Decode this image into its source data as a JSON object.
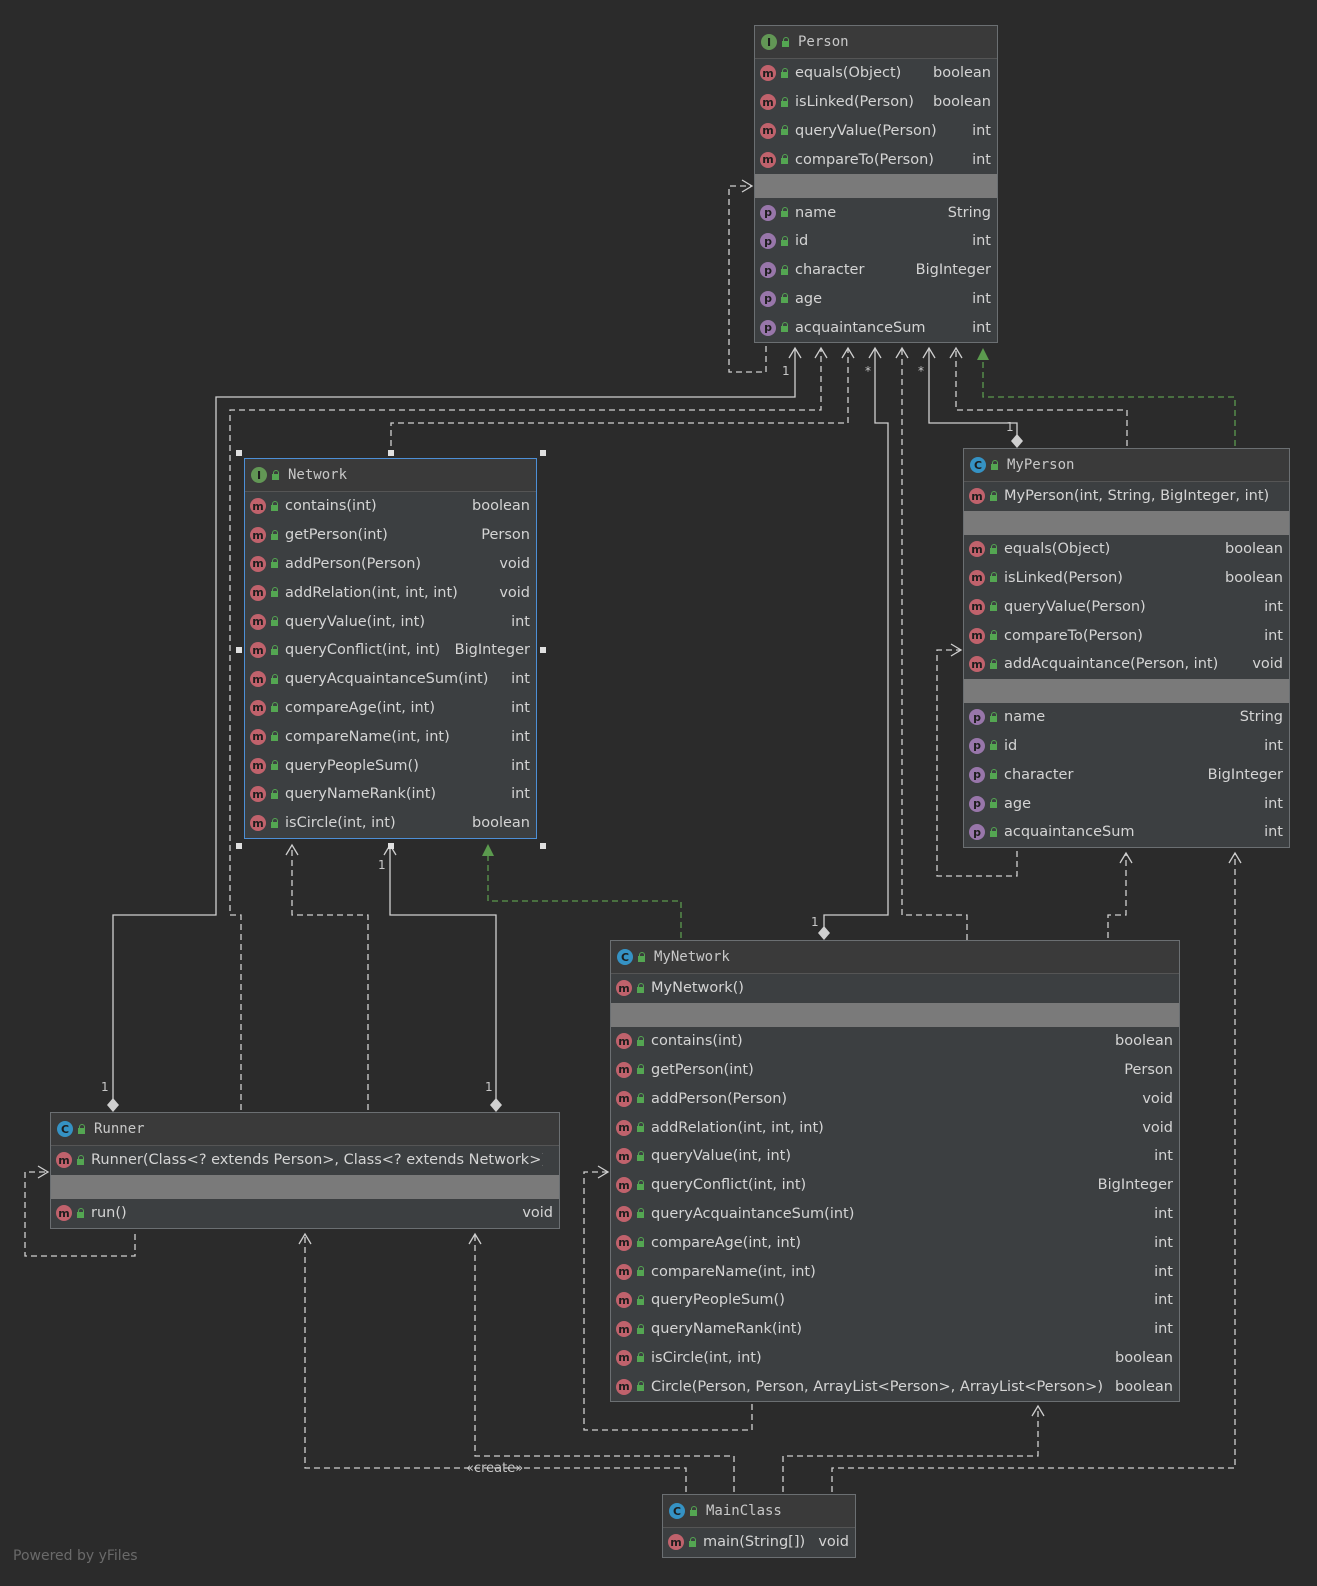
{
  "diagram": {
    "classes": [
      {
        "id": "person",
        "kind": "I",
        "name": "Person",
        "methods": [
          [
            "equals(Object)",
            "boolean"
          ],
          [
            "isLinked(Person)",
            "boolean"
          ],
          [
            "queryValue(Person)",
            "int"
          ],
          [
            "compareTo(Person)",
            "int"
          ]
        ],
        "fields": [
          [
            "name",
            "String"
          ],
          [
            "id",
            "int"
          ],
          [
            "character",
            "BigInteger"
          ],
          [
            "age",
            "int"
          ],
          [
            "acquaintanceSum",
            "int"
          ]
        ]
      },
      {
        "id": "network",
        "kind": "I",
        "name": "Network",
        "selected": true,
        "methods": [
          [
            "contains(int)",
            "boolean"
          ],
          [
            "getPerson(int)",
            "Person"
          ],
          [
            "addPerson(Person)",
            "void"
          ],
          [
            "addRelation(int, int, int)",
            "void"
          ],
          [
            "queryValue(int, int)",
            "int"
          ],
          [
            "queryConflict(int, int)",
            "BigInteger"
          ],
          [
            "queryAcquaintanceSum(int)",
            "int"
          ],
          [
            "compareAge(int, int)",
            "int"
          ],
          [
            "compareName(int, int)",
            "int"
          ],
          [
            "queryPeopleSum()",
            "int"
          ],
          [
            "queryNameRank(int)",
            "int"
          ],
          [
            "isCircle(int, int)",
            "boolean"
          ]
        ]
      },
      {
        "id": "myperson",
        "kind": "C",
        "name": "MyPerson",
        "ctors": [
          [
            "MyPerson(int, String, BigInteger, int)",
            ""
          ]
        ],
        "methods": [
          [
            "equals(Object)",
            "boolean"
          ],
          [
            "isLinked(Person)",
            "boolean"
          ],
          [
            "queryValue(Person)",
            "int"
          ],
          [
            "compareTo(Person)",
            "int"
          ],
          [
            "addAcquaintance(Person, int)",
            "void"
          ]
        ],
        "fields": [
          [
            "name",
            "String"
          ],
          [
            "id",
            "int"
          ],
          [
            "character",
            "BigInteger"
          ],
          [
            "age",
            "int"
          ],
          [
            "acquaintanceSum",
            "int"
          ]
        ]
      },
      {
        "id": "mynetwork",
        "kind": "C",
        "name": "MyNetwork",
        "ctors": [
          [
            "MyNetwork()",
            ""
          ]
        ],
        "methods": [
          [
            "contains(int)",
            "boolean"
          ],
          [
            "getPerson(int)",
            "Person"
          ],
          [
            "addPerson(Person)",
            "void"
          ],
          [
            "addRelation(int, int, int)",
            "void"
          ],
          [
            "queryValue(int, int)",
            "int"
          ],
          [
            "queryConflict(int, int)",
            "BigInteger"
          ],
          [
            "queryAcquaintanceSum(int)",
            "int"
          ],
          [
            "compareAge(int, int)",
            "int"
          ],
          [
            "compareName(int, int)",
            "int"
          ],
          [
            "queryPeopleSum()",
            "int"
          ],
          [
            "queryNameRank(int)",
            "int"
          ],
          [
            "isCircle(int, int)",
            "boolean"
          ],
          [
            "Circle(Person, Person, ArrayList<Person>, ArrayList<Person>)",
            "boolean"
          ]
        ]
      },
      {
        "id": "runner",
        "kind": "C",
        "name": "Runner",
        "ctors": [
          [
            "Runner(Class<? extends Person>, Class<? extends Network>)",
            ""
          ]
        ],
        "methods": [
          [
            "run()",
            "void"
          ]
        ]
      },
      {
        "id": "mainclass",
        "kind": "C",
        "name": "MainClass",
        "methods": [
          [
            "main(String[])",
            "void"
          ]
        ]
      }
    ],
    "multiplicity_labels": [
      "1",
      "*",
      "*",
      "1",
      "1",
      "1",
      "1",
      "1"
    ],
    "stereotype_label": "«create»",
    "footer": "Powered by yFiles"
  }
}
